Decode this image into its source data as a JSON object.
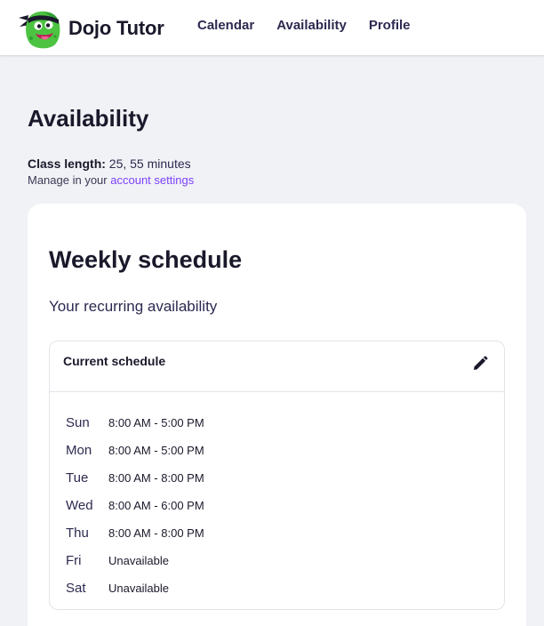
{
  "header": {
    "brand": "Dojo Tutor",
    "nav": [
      {
        "label": "Calendar"
      },
      {
        "label": "Availability"
      },
      {
        "label": "Profile"
      }
    ]
  },
  "page": {
    "title": "Availability",
    "class_length_label": "Class length:",
    "class_length_value": "25, 55 minutes",
    "manage_prefix": "Manage in your",
    "manage_link": "account settings"
  },
  "weekly": {
    "title": "Weekly schedule",
    "subtitle": "Your recurring availability",
    "current_title": "Current schedule",
    "days": [
      {
        "day": "Sun",
        "hours": "8:00 AM - 5:00 PM"
      },
      {
        "day": "Mon",
        "hours": "8:00 AM - 5:00 PM"
      },
      {
        "day": "Tue",
        "hours": "8:00 AM - 8:00 PM"
      },
      {
        "day": "Wed",
        "hours": "8:00 AM - 6:00 PM"
      },
      {
        "day": "Thu",
        "hours": "8:00 AM - 8:00 PM"
      },
      {
        "day": "Fri",
        "hours": "Unavailable"
      },
      {
        "day": "Sat",
        "hours": "Unavailable"
      }
    ]
  },
  "icons": {
    "logo": "dojo-monster-logo-icon",
    "edit": "pencil-icon"
  },
  "colors": {
    "background": "#f1f2f6",
    "link": "#7d40ff",
    "nav_text": "#2c2a50",
    "logo_green": "#4cc341"
  }
}
